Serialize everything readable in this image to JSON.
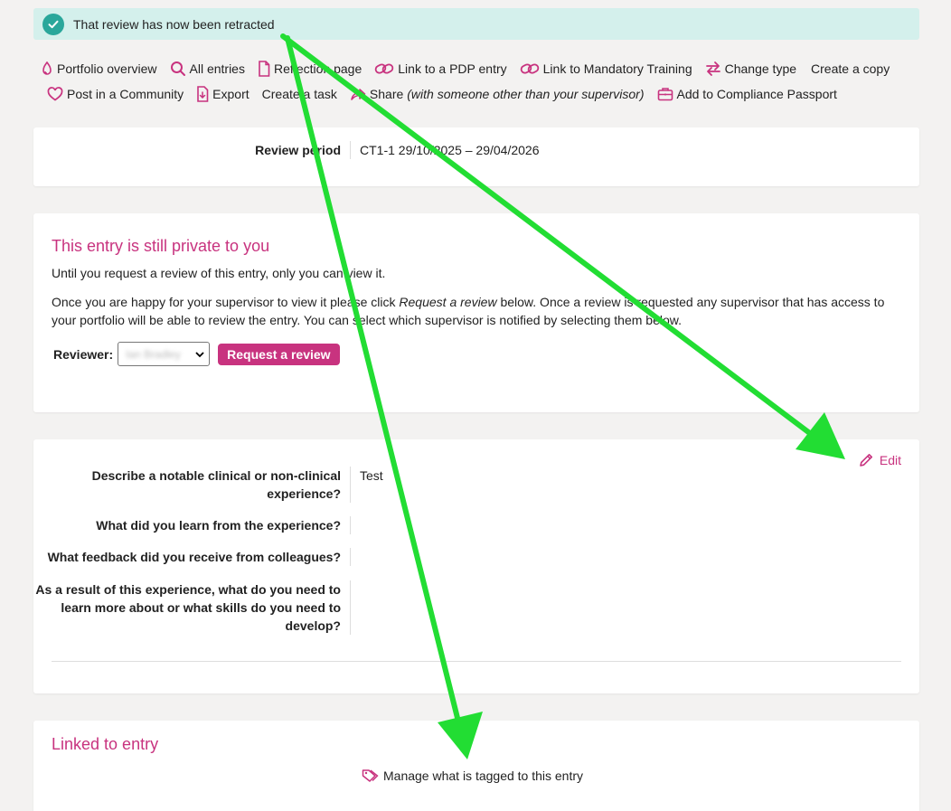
{
  "alert": {
    "message": "That review has now been retracted"
  },
  "actions": {
    "row1": [
      {
        "label": "Portfolio overview",
        "icon": "portfolio-icon"
      },
      {
        "label": "All entries",
        "icon": "search-icon"
      },
      {
        "label": "Reflection page",
        "icon": "document-icon"
      },
      {
        "label": "Link to a PDP entry",
        "icon": "link-icon"
      },
      {
        "label": "Link to Mandatory Training",
        "icon": "link-icon"
      },
      {
        "label": "Change type",
        "icon": "swap-icon"
      },
      {
        "label": "Create a copy",
        "icon": ""
      }
    ],
    "row2": [
      {
        "label": "Post in a Community",
        "icon": "heart-icon"
      },
      {
        "label": "Export",
        "icon": "export-icon"
      },
      {
        "label": "Create a task",
        "icon": ""
      },
      {
        "label": "Share",
        "icon": "share-icon",
        "note": "(with someone other than your supervisor)"
      },
      {
        "label": "Add to Compliance Passport",
        "icon": "briefcase-icon"
      }
    ]
  },
  "review_period": {
    "label": "Review period",
    "value": "CT1-1 29/10/2025 – 29/04/2026"
  },
  "private": {
    "title": "This entry is still private to you",
    "line1": "Until you request a review of this entry, only you can view it.",
    "line2_before": "Once you are happy for your supervisor to view it please click ",
    "line2_emph": "Request a review",
    "line2_after": " below. Once a review is requested any supervisor that has access to your portfolio will be able to review the entry. You can select which supervisor is notified by selecting them below.",
    "reviewer_label": "Reviewer:",
    "reviewer_value": "Ian Bradley",
    "request_button": "Request a review"
  },
  "entry": {
    "edit_label": "Edit",
    "fields": [
      {
        "question": "Describe a notable clinical or non-clinical experience?",
        "answer": "Test"
      },
      {
        "question": "What did you learn from the experience?",
        "answer": ""
      },
      {
        "question": "What feedback did you receive from colleagues?",
        "answer": ""
      },
      {
        "question": "As a result of this experience, what do you need to learn more about or what skills do you need to develop?",
        "answer": ""
      }
    ]
  },
  "linked": {
    "title": "Linked to entry",
    "manage_label": "Manage what is tagged to this entry"
  },
  "colors": {
    "accent": "#c8337f",
    "success": "#2aa79b",
    "annotation": "#22dd33"
  }
}
